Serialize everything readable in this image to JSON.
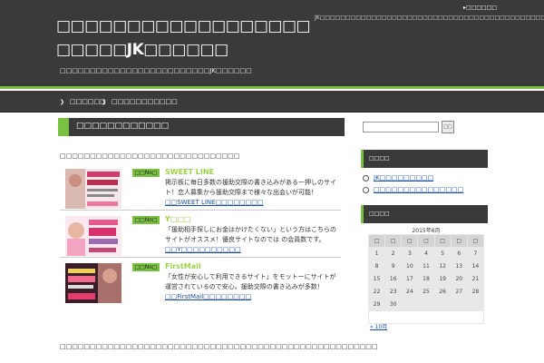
{
  "header": {
    "title": "□□□□□□□□□□□□□□□□□□□□□□□JK□□□□□□",
    "description": "□□□□□□□□□□□□□□□□□□□□□□□□□JK□□□□□□",
    "note": "JK□□□□□□□□□□□□□□□□□□□□□□□□□□□□□□□□□□□□□□□□□□□□□□□□",
    "top_link": "□□□□□□"
  },
  "nav": {
    "items": [
      "□□□□□□",
      "□□□□□□□□□□□"
    ]
  },
  "main": {
    "title": "□□□□□□□□□□□□",
    "intro": "□□□□□□□□□□□□□□□□□□□□□□□□□□□□□□",
    "sites": [
      {
        "rank": "□□No□",
        "name": "SWEET LINE",
        "desc": "掲示板に毎日多数の援助交際の書き込みがある一押しのサイト！恋人募集から援助交際まで様々な出会いが可能！",
        "link": "□□SWEET LINE□□□□□□□□"
      },
      {
        "rank": "□□No□",
        "name": "Y□□□",
        "desc": "「援助相手探しにお金はかけたくない」という方はこちらのサイトがオススメ！優良サイトなのでは の会員数です。",
        "link": "□□Y□□□□□□□□□□"
      },
      {
        "rank": "□□No□",
        "name": "FirstMail",
        "desc": "「女性が安心して利用できるサイト」をモットーにサイトが運営されているので安心。援助交際の書き込みが多数！",
        "link": "□□FirstMail□□□□□□□□"
      }
    ],
    "footer": "□□□□□□□□□□□□□□□□□□□□□□□□□□□□□□□□□□□□□□□□□□□□□□□□□□□□□"
  },
  "sidebar": {
    "search_button": "□□",
    "widget1_title": "□□□□",
    "widget1_items": [
      "JK□□□□□□□□□",
      "□□□□□□□□□□□□□□□"
    ],
    "widget2_title": "□□□□",
    "calendar": {
      "caption": "2015年6月",
      "weekdays": [
        "□",
        "□",
        "□",
        "□",
        "□",
        "□",
        "□"
      ],
      "weeks": [
        [
          "1",
          "2",
          "3",
          "4",
          "5",
          "6",
          "7"
        ],
        [
          "8",
          "9",
          "10",
          "11",
          "12",
          "13",
          "14"
        ],
        [
          "15",
          "16",
          "17",
          "18",
          "19",
          "20",
          "21"
        ],
        [
          "22",
          "23",
          "24",
          "25",
          "26",
          "27",
          "28"
        ],
        [
          "29",
          "30",
          "",
          "",
          "",
          "",
          ""
        ]
      ],
      "prev": "« 10月"
    }
  }
}
